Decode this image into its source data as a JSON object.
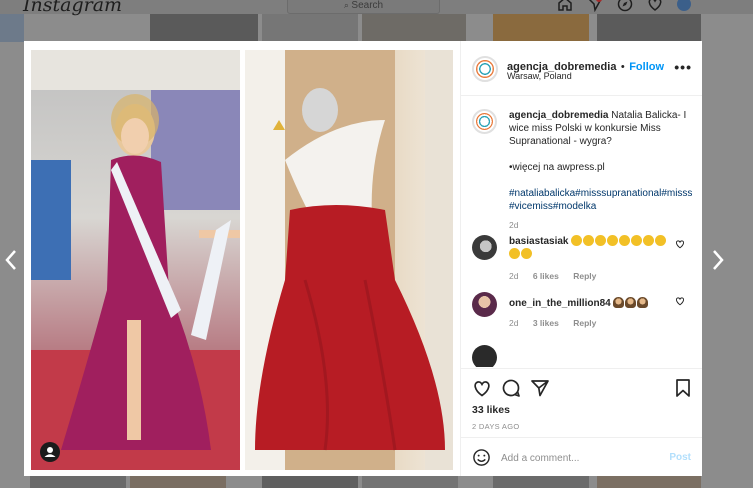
{
  "background": {
    "logo": "Instagram",
    "search_placeholder": "Search",
    "nav_icons": [
      "home-icon",
      "direct-icon",
      "explore-icon",
      "activity-icon",
      "profile-avatar"
    ]
  },
  "post": {
    "author": "agencja_dobremedia",
    "follow_label": "Follow",
    "dot": "•",
    "location": "Warsaw, Poland",
    "more_label": "•••",
    "caption": {
      "username": "agencja_dobremedia",
      "text": "Natalia Balicka- I wice miss Polski w konkursie Miss Supranational - wygra?",
      "more_info": "•więcej na awpress.pl",
      "hashtags": "#nataliabalicka#misssupranational#misss#vicemiss#modelka",
      "time": "2d"
    },
    "comments": [
      {
        "username": "basiastasiak",
        "emoji_count": 10,
        "emoji_type": "laugh",
        "time": "2d",
        "likes": "6 likes",
        "reply_label": "Reply"
      },
      {
        "username": "one_in_the_million84",
        "emoji_count": 3,
        "emoji_type": "person",
        "time": "2d",
        "likes": "3 likes",
        "reply_label": "Reply"
      }
    ],
    "likes": "33 likes",
    "date": "2 DAYS AGO",
    "comment_placeholder": "Add a comment...",
    "post_label": "Post"
  },
  "colors": {
    "accent": "#0095f6",
    "overlay": "#8c8c8c",
    "muted": "#8e8e8e",
    "dress_left": "#a01f5e",
    "dress_right": "#b71c24"
  }
}
